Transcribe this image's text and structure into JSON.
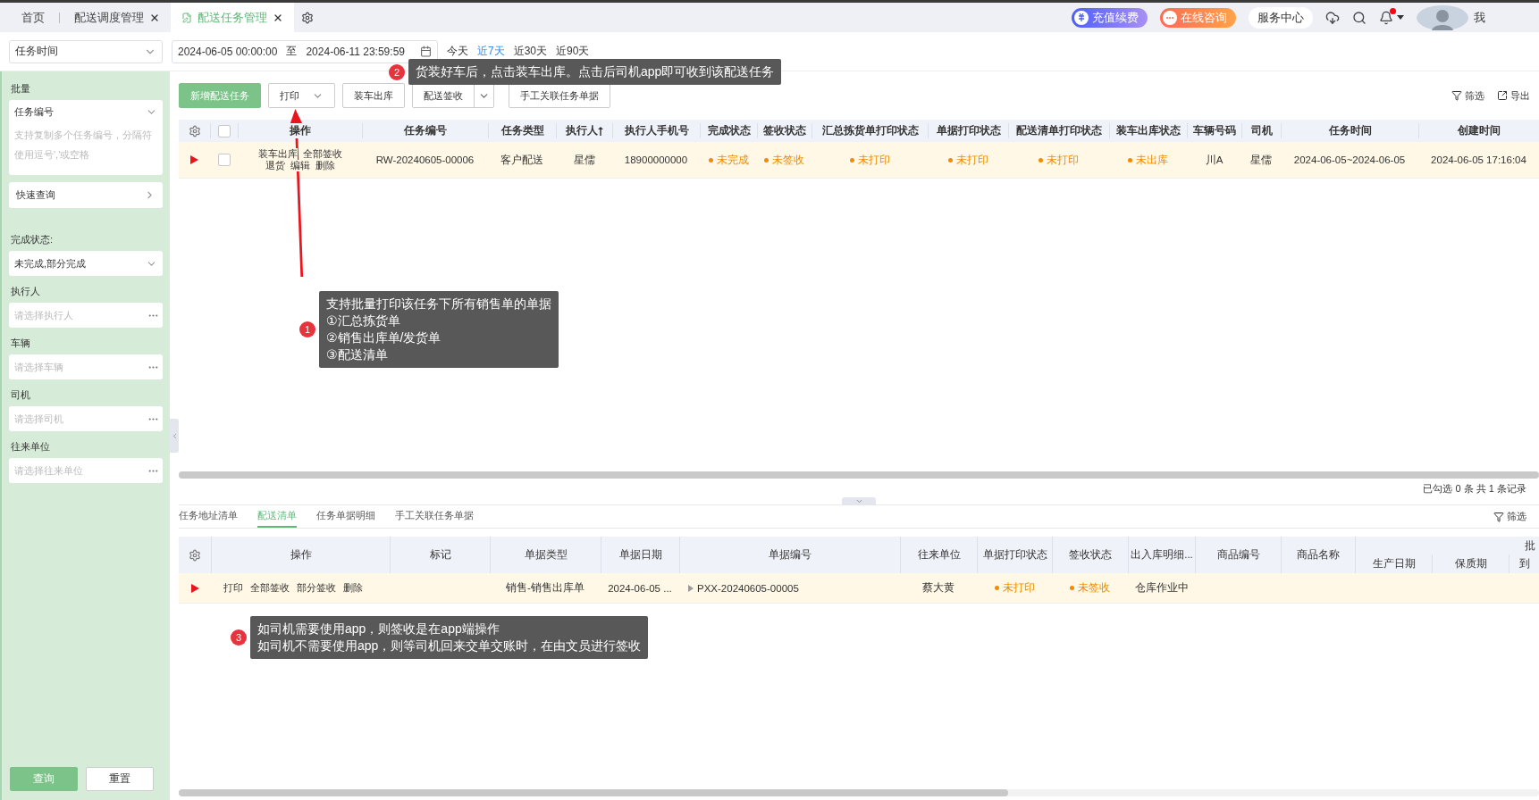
{
  "tabs": [
    {
      "label": "首页",
      "closable": false,
      "selected": false
    },
    {
      "label": "配送调度管理",
      "closable": true,
      "selected": false
    },
    {
      "label": "配送任务管理",
      "closable": true,
      "selected": true
    }
  ],
  "header_actions": {
    "recharge": "充值续费",
    "consult": "在线咨询",
    "service": "服务中心",
    "user": "我"
  },
  "filter_bar": {
    "date_type": "任务时间",
    "start": "2024-06-05 00:00:00",
    "separator": "至",
    "end": "2024-06-11 23:59:59",
    "quick_ranges": [
      {
        "label": "今天",
        "selected": false
      },
      {
        "label": "近7天",
        "selected": true
      },
      {
        "label": "近30天",
        "selected": false
      },
      {
        "label": "近90天",
        "selected": false
      }
    ]
  },
  "sidebar": {
    "batch_label": "批量",
    "batch_type": "任务编号",
    "batch_placeholder": "支持复制多个任务编号，分隔符使用逗号','或空格",
    "quick_query": "快速查询",
    "filters": [
      {
        "label": "完成状态:",
        "kind": "select",
        "value": "未完成,部分完成"
      },
      {
        "label": "执行人",
        "kind": "picker",
        "placeholder": "请选择执行人"
      },
      {
        "label": "车辆",
        "kind": "picker",
        "placeholder": "请选择车辆"
      },
      {
        "label": "司机",
        "kind": "picker",
        "placeholder": "请选择司机"
      },
      {
        "label": "往来单位",
        "kind": "picker",
        "placeholder": "请选择往来单位"
      }
    ],
    "buttons": [
      {
        "label": "查询",
        "primary": true
      },
      {
        "label": "重置",
        "primary": false
      }
    ]
  },
  "toolbar": {
    "buttons": [
      {
        "label": "新增配送任务",
        "kind": "primary"
      },
      {
        "label": "打印",
        "kind": "dropdown"
      },
      {
        "label": "装车出库",
        "kind": "plain"
      },
      {
        "label": "配送签收",
        "kind": "split"
      },
      {
        "label": "手工关联任务单据",
        "kind": "plain"
      }
    ],
    "filter": "筛选",
    "export": "导出"
  },
  "task_table": {
    "header_checked": false,
    "columns": [
      "操作",
      "任务编号",
      "任务类型",
      "执行人",
      "执行人手机号",
      "完成状态",
      "签收状态",
      "汇总拣货单打印状态",
      "单据打印状态",
      "配送清单打印状态",
      "装车出库状态",
      "车辆号码",
      "司机",
      "任务时间",
      "创建时间"
    ],
    "rows": [
      {
        "selected": true,
        "checked": false,
        "cells": [
          {
            "kind": "actions",
            "actions": [
              "装车出库",
              "全部签收",
              "退货",
              "编辑",
              "删除"
            ]
          },
          {
            "kind": "text",
            "text": "RW-20240605-00006"
          },
          {
            "kind": "text",
            "text": "客户配送"
          },
          {
            "kind": "text",
            "text": "星儒"
          },
          {
            "kind": "text",
            "text": "18900000000"
          },
          {
            "kind": "status",
            "text": "未完成"
          },
          {
            "kind": "status",
            "text": "未签收"
          },
          {
            "kind": "status",
            "text": "未打印"
          },
          {
            "kind": "status",
            "text": "未打印"
          },
          {
            "kind": "status",
            "text": "未打印"
          },
          {
            "kind": "status",
            "text": "未出库"
          },
          {
            "kind": "text",
            "text": "川A"
          },
          {
            "kind": "text",
            "text": "星儒"
          },
          {
            "kind": "text",
            "text": "2024-06-05~2024-06-05"
          },
          {
            "kind": "text",
            "text": "2024-06-05 17:16:04"
          }
        ]
      }
    ]
  },
  "selection_info": "已勾选 0 条 共 1 条记录",
  "detail_tabs": [
    {
      "label": "任务地址清单",
      "selected": false
    },
    {
      "label": "配送清单",
      "selected": true
    },
    {
      "label": "任务单据明细",
      "selected": false
    },
    {
      "label": "手工关联任务单据",
      "selected": false
    }
  ],
  "detail_filter": "筛选",
  "detail_table": {
    "columns": [
      "操作",
      "标记",
      "单据类型",
      "单据日期",
      "单据编号",
      "往来单位",
      "单据打印状态",
      "签收状态",
      "出入库明细...",
      "商品编号",
      "商品名称"
    ],
    "group": {
      "label": "批",
      "children": [
        "生产日期",
        "保质期",
        "到"
      ]
    },
    "rows": [
      {
        "selected": true,
        "cells": [
          {
            "kind": "actions",
            "actions": [
              "打印",
              "全部签收",
              "部分签收",
              "删除"
            ]
          },
          {
            "kind": "empty"
          },
          {
            "kind": "text",
            "text": "销售-销售出库单"
          },
          {
            "kind": "text",
            "text": "2024-06-05 ..."
          },
          {
            "kind": "expand",
            "text": "PXX-20240605-00005"
          },
          {
            "kind": "text",
            "text": "蔡大黄"
          },
          {
            "kind": "status",
            "text": "未打印"
          },
          {
            "kind": "status",
            "text": "未签收"
          },
          {
            "kind": "text",
            "text": "仓库作业中"
          },
          {
            "kind": "empty"
          },
          {
            "kind": "empty"
          },
          {
            "kind": "empty"
          },
          {
            "kind": "empty"
          },
          {
            "kind": "empty"
          }
        ]
      }
    ]
  },
  "annotations": [
    {
      "number": "2",
      "lines": [
        "货装好车后，点击装车出库。点击后司机app即可收到该配送任务"
      ]
    },
    {
      "number": "1",
      "lines": [
        "支持批量打印该任务下所有销售单的单据",
        "①汇总拣货单",
        "②销售出库单/发货单",
        "③配送清单"
      ]
    },
    {
      "number": "3",
      "lines": [
        "如司机需要使用app，则签收是在app端操作",
        "如司机不需要使用app，则等司机回来交单交账时，在由文员进行签收"
      ]
    }
  ]
}
